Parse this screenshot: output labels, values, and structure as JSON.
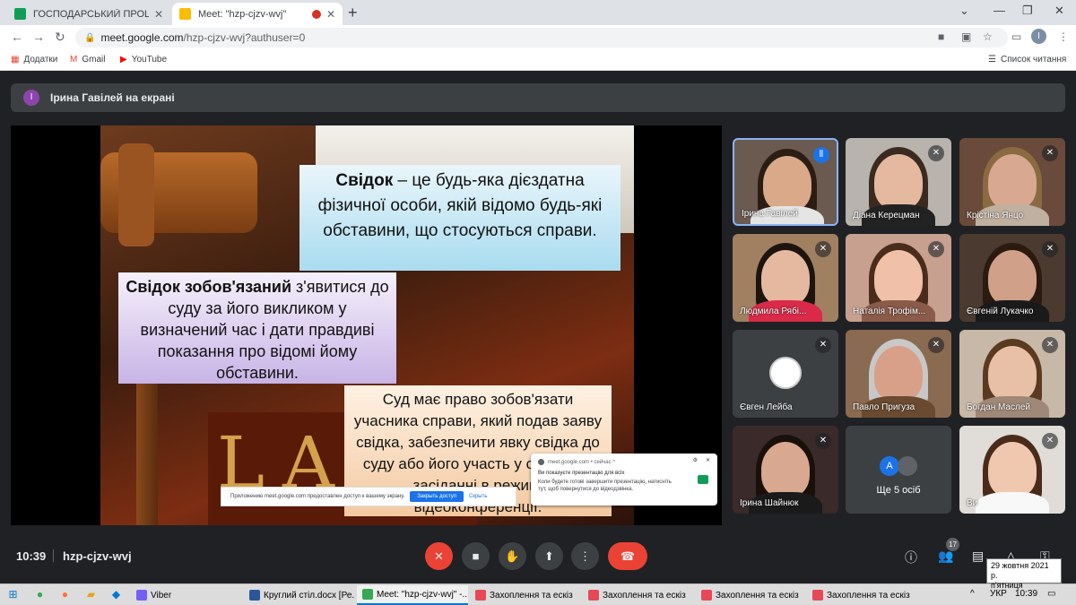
{
  "browser": {
    "tabs": [
      {
        "title": "ГОСПОДАРСЬКИЙ ПРОЦЕС Пр",
        "active": false,
        "favicon_color": "#0f9d58"
      },
      {
        "title": "Meet: \"hzp-cjzv-wvj\"",
        "active": true,
        "favicon_color": "#fbbc04"
      }
    ],
    "url_domain": "meet.google.com",
    "url_path": "/hzp-cjzv-wvj?authuser=0",
    "profile_initial": "I",
    "bookmarks": [
      "Додатки",
      "Gmail",
      "YouTube"
    ],
    "reading_list": "Список читання"
  },
  "meet": {
    "presenting_initial": "І",
    "presenting_text": "Ірина Гавілей на екрані",
    "time": "10:39",
    "meeting_code": "hzp-cjzv-wvj",
    "participants_count": "17",
    "more_label": "Ще 5 осіб",
    "more_initial": "А"
  },
  "slide": {
    "box1_bold": "Свідок",
    "box1_text": " – це  будь-яка дієздатна фізичної особи, якій відомо будь-які обставини, що стосуються справи.",
    "box2_bold": "Свідок зобов'язаний",
    "box2_text": " з'явитися до суду за його викликом у визначений час і дати правдиві показання про відомі йому обставини.",
    "box3_text": "Суд має право зобов'язати учасника справи, який подав заяву свідка, забезпечити явку свідка до суду або його участь у судовому засіданні в режимі відеоконференції.",
    "book_text": "LA"
  },
  "notice": {
    "text": "Приложению meet.google.com предоставлен доступ к вашему экрану.",
    "button": "Закрыть доступ",
    "hide": "Скрыть"
  },
  "popup": {
    "source": "meet.google.com • сейчас ^",
    "title": "Ви показуєте презентацію для всіх",
    "body": "Коли будете готові завершити презентацію, натисніть тут, щоб повернутися до відеодзвінка."
  },
  "participants": [
    {
      "name": "Ірина Гавілей",
      "speaking": true
    },
    {
      "name": "Діана Керецман",
      "speaking": false
    },
    {
      "name": "Крістіна Янцо",
      "speaking": false
    },
    {
      "name": "Людмила Рябі...",
      "speaking": false
    },
    {
      "name": "Наталія Трофім...",
      "speaking": false
    },
    {
      "name": "Євгеній Лукачко",
      "speaking": false
    },
    {
      "name": "Євген Лейба",
      "speaking": false
    },
    {
      "name": "Павло Пригуза",
      "speaking": false
    },
    {
      "name": "Богдан Маслей",
      "speaking": false
    },
    {
      "name": "Ірина Шайнюк",
      "speaking": false
    },
    {
      "name": "Ви",
      "speaking": false
    }
  ],
  "datetip": {
    "date": "29 жовтня 2021 р.",
    "day": "п'ятниця"
  },
  "taskbar": {
    "items": [
      "Viber",
      "Круглий стіл.docx [Ре...",
      "Meet: \"hzp-cjzv-wvj\" -...",
      "Захоплення та ескіз",
      "Захоплення та ескіз",
      "Захоплення та ескіз",
      "Захоплення та ескіз"
    ],
    "lang": "УКР",
    "time": "10:39"
  }
}
